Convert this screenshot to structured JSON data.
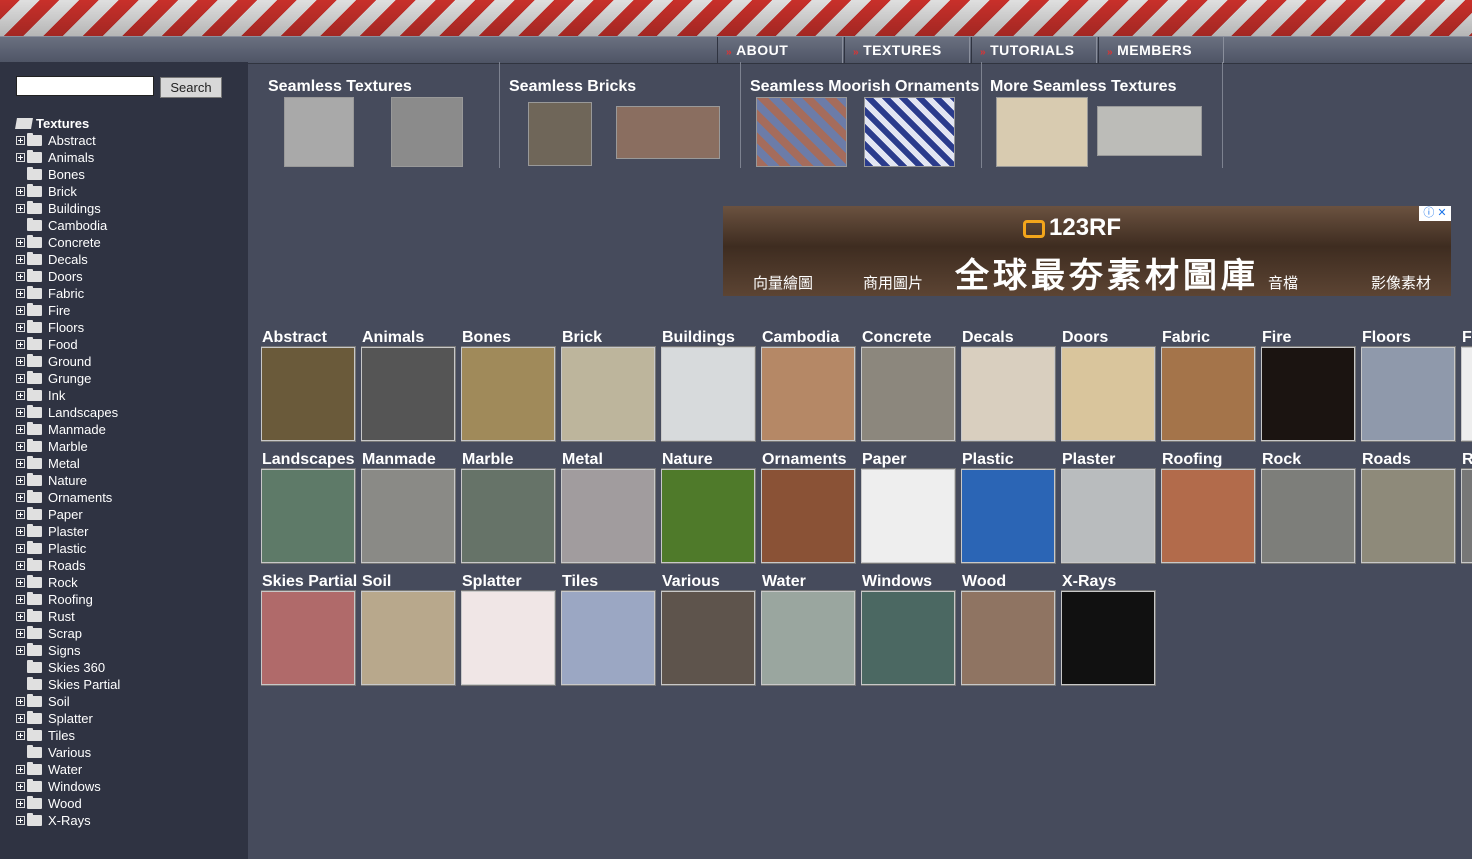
{
  "nav": {
    "items": [
      "ABOUT",
      "TEXTURES",
      "TUTORIALS",
      "MEMBERS"
    ],
    "arrow": "»"
  },
  "search": {
    "value": "",
    "button_label": "Search"
  },
  "tree": {
    "root": "Textures",
    "items": [
      {
        "label": "Abstract",
        "expandable": true
      },
      {
        "label": "Animals",
        "expandable": true
      },
      {
        "label": "Bones",
        "expandable": false
      },
      {
        "label": "Brick",
        "expandable": true
      },
      {
        "label": "Buildings",
        "expandable": true
      },
      {
        "label": "Cambodia",
        "expandable": false
      },
      {
        "label": "Concrete",
        "expandable": true
      },
      {
        "label": "Decals",
        "expandable": true
      },
      {
        "label": "Doors",
        "expandable": true
      },
      {
        "label": "Fabric",
        "expandable": true
      },
      {
        "label": "Fire",
        "expandable": true
      },
      {
        "label": "Floors",
        "expandable": true
      },
      {
        "label": "Food",
        "expandable": true
      },
      {
        "label": "Ground",
        "expandable": true
      },
      {
        "label": "Grunge",
        "expandable": true
      },
      {
        "label": "Ink",
        "expandable": true
      },
      {
        "label": "Landscapes",
        "expandable": true
      },
      {
        "label": "Manmade",
        "expandable": true
      },
      {
        "label": "Marble",
        "expandable": true
      },
      {
        "label": "Metal",
        "expandable": true
      },
      {
        "label": "Nature",
        "expandable": true
      },
      {
        "label": "Ornaments",
        "expandable": true
      },
      {
        "label": "Paper",
        "expandable": true
      },
      {
        "label": "Plaster",
        "expandable": true
      },
      {
        "label": "Plastic",
        "expandable": true
      },
      {
        "label": "Roads",
        "expandable": true
      },
      {
        "label": "Rock",
        "expandable": true
      },
      {
        "label": "Roofing",
        "expandable": true
      },
      {
        "label": "Rust",
        "expandable": true
      },
      {
        "label": "Scrap",
        "expandable": true
      },
      {
        "label": "Signs",
        "expandable": true
      },
      {
        "label": "Skies 360",
        "expandable": false
      },
      {
        "label": "Skies Partial",
        "expandable": false
      },
      {
        "label": "Soil",
        "expandable": true
      },
      {
        "label": "Splatter",
        "expandable": true
      },
      {
        "label": "Tiles",
        "expandable": true
      },
      {
        "label": "Various",
        "expandable": false
      },
      {
        "label": "Water",
        "expandable": true
      },
      {
        "label": "Windows",
        "expandable": true
      },
      {
        "label": "Wood",
        "expandable": true
      },
      {
        "label": "X-Rays",
        "expandable": true
      }
    ]
  },
  "featured": [
    {
      "title": "Seamless Textures"
    },
    {
      "title": "Seamless Bricks"
    },
    {
      "title": "Seamless Moorish Ornaments"
    },
    {
      "title": "More Seamless Textures"
    }
  ],
  "ad": {
    "brand": "123RF",
    "headline": "全球最夯素材圖庫",
    "captions": [
      "向量繪圖",
      "商用圖片",
      "音檔",
      "影像素材"
    ],
    "close": "ⓘ ✕"
  },
  "categories": [
    {
      "label": "Abstract",
      "color": "#6a5a3a"
    },
    {
      "label": "Animals",
      "color": "#555555"
    },
    {
      "label": "Bones",
      "color": "#a08a5a"
    },
    {
      "label": "Brick",
      "color": "#bdb59c"
    },
    {
      "label": "Buildings",
      "color": "#d7dadc"
    },
    {
      "label": "Cambodia",
      "color": "#b58866"
    },
    {
      "label": "Concrete",
      "color": "#8c877d"
    },
    {
      "label": "Decals",
      "color": "#d9cfbf"
    },
    {
      "label": "Doors",
      "color": "#d9c59c"
    },
    {
      "label": "Fabric",
      "color": "#a4744a"
    },
    {
      "label": "Fire",
      "color": "#1b1411"
    },
    {
      "label": "Floors",
      "color": "#8f99ab"
    },
    {
      "label": "Fo",
      "color": "#eeeeee"
    },
    {
      "label": "Landscapes",
      "color": "#5e7a68"
    },
    {
      "label": "Manmade",
      "color": "#8a8a86"
    },
    {
      "label": "Marble",
      "color": "#667368"
    },
    {
      "label": "Metal",
      "color": "#a19c9e"
    },
    {
      "label": "Nature",
      "color": "#4f7a2a"
    },
    {
      "label": "Ornaments",
      "color": "#8a5236"
    },
    {
      "label": "Paper",
      "color": "#eeeeee"
    },
    {
      "label": "Plastic",
      "color": "#2b65b5"
    },
    {
      "label": "Plaster",
      "color": "#b9bcbe"
    },
    {
      "label": "Roofing",
      "color": "#b26b4b"
    },
    {
      "label": "Rock",
      "color": "#7d7e7a"
    },
    {
      "label": "Roads",
      "color": "#8e8a7a"
    },
    {
      "label": "R",
      "color": "#777777"
    },
    {
      "label": "Skies Partial",
      "color": "#b06a6a"
    },
    {
      "label": "Soil",
      "color": "#b8a88c"
    },
    {
      "label": "Splatter",
      "color": "#f0e6e6"
    },
    {
      "label": "Tiles",
      "color": "#9ba7c3"
    },
    {
      "label": "Various",
      "color": "#5e544c"
    },
    {
      "label": "Water",
      "color": "#9aa69f"
    },
    {
      "label": "Windows",
      "color": "#4b6862"
    },
    {
      "label": "Wood",
      "color": "#8f7462"
    },
    {
      "label": "X-Rays",
      "color": "#111111"
    }
  ]
}
